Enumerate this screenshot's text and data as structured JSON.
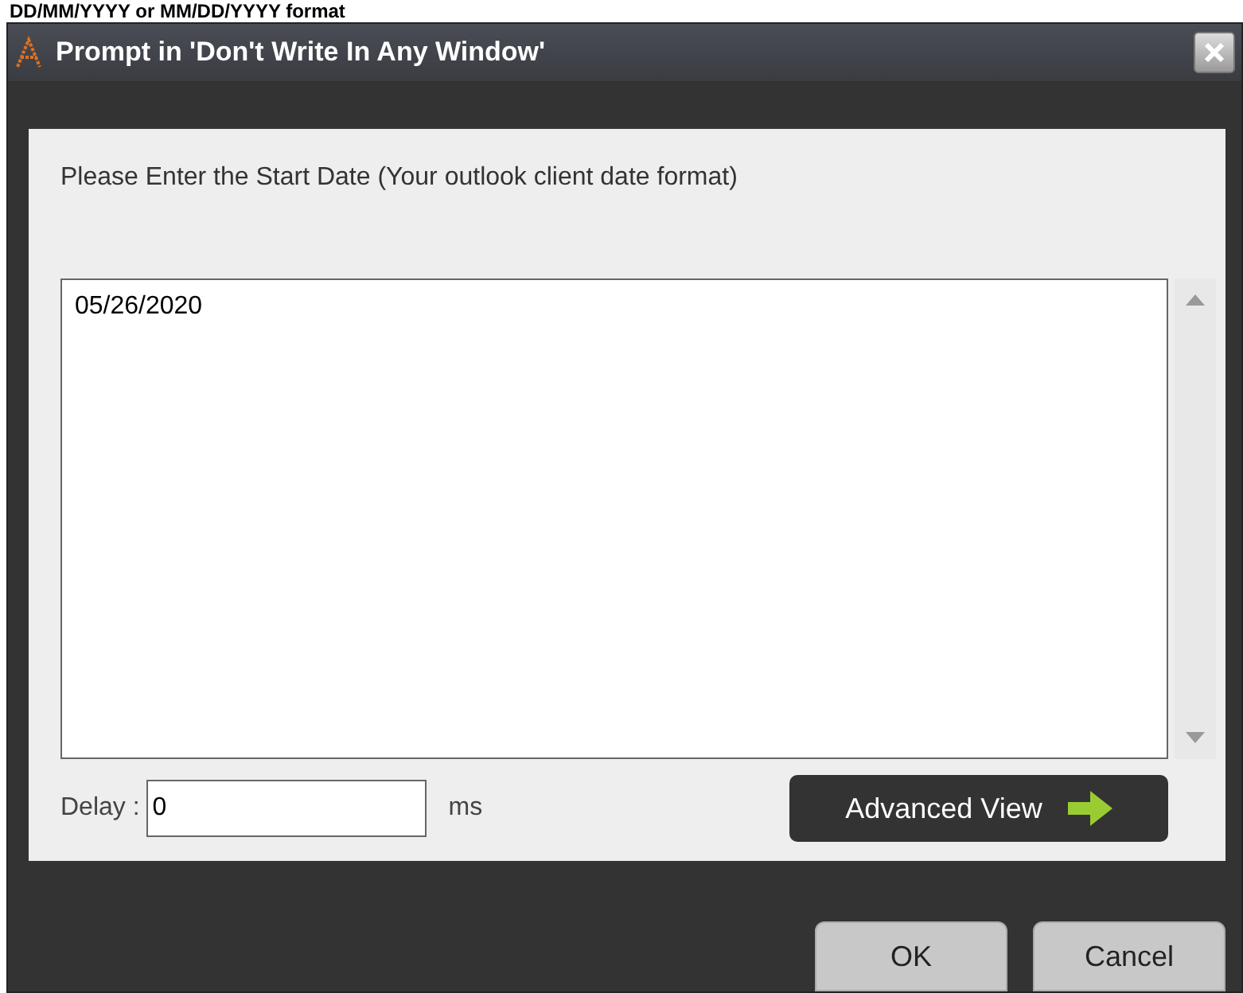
{
  "page_header": {
    "text": "DD/MM/YYYY or MM/DD/YYYY format"
  },
  "window": {
    "title": "Prompt in 'Don't Write In Any Window'"
  },
  "prompt": {
    "text": "Please Enter the Start Date (Your outlook client date format)"
  },
  "answer": {
    "value": "05/26/2020"
  },
  "delay": {
    "label": "Delay :",
    "value": "0",
    "unit": "ms"
  },
  "advanced_button": {
    "label": "Advanced View"
  },
  "buttons": [
    {
      "label": "OK"
    },
    {
      "label": "Cancel"
    }
  ]
}
